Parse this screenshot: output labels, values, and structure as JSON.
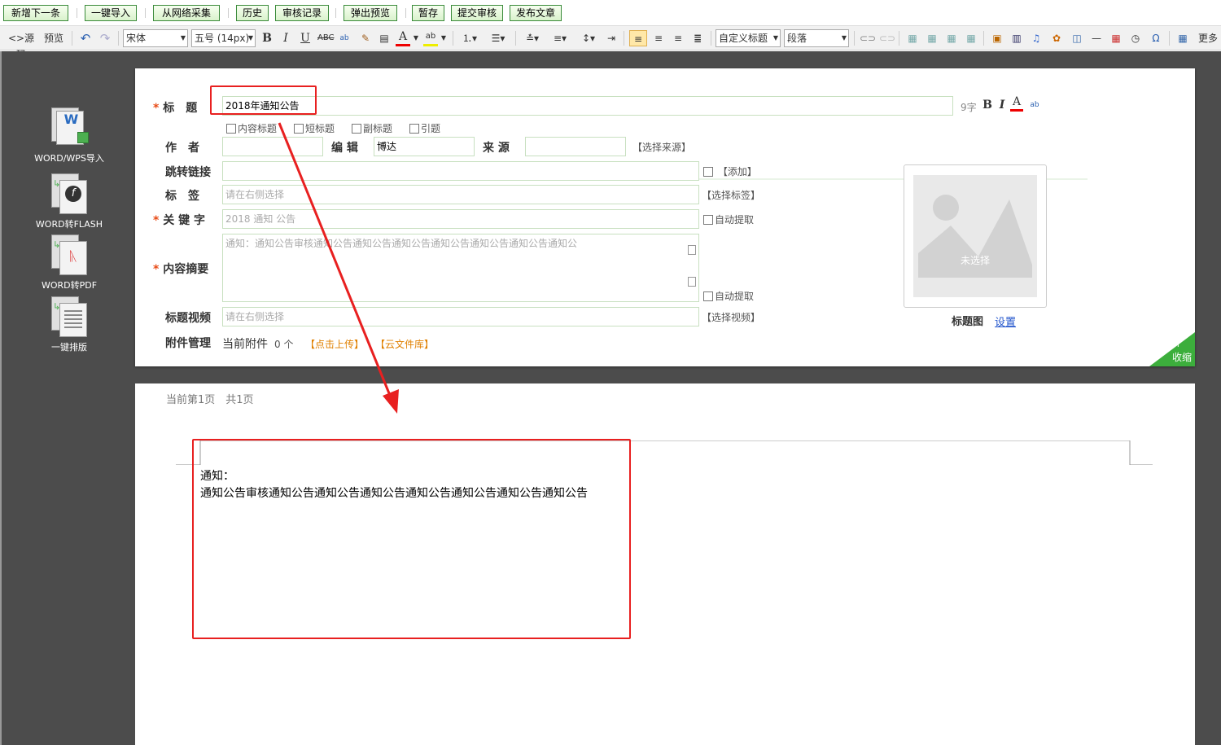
{
  "actions": [
    "新增下一条",
    "一键导入",
    "从网络采集",
    "历史",
    "审核记录",
    "弹出预览",
    "暂存",
    "提交审核",
    "发布文章"
  ],
  "toolbar": {
    "source": "源码",
    "preview": "预览",
    "font": "宋体",
    "size": "五号 (14px)",
    "heading": "自定义标题",
    "paragraph": "段落",
    "more": "更多"
  },
  "left_tools": [
    {
      "label": "WORD/WPS导入",
      "icon": "word-import-icon"
    },
    {
      "label": "WORD转FLASH",
      "icon": "word-to-flash-icon"
    },
    {
      "label": "WORD转PDF",
      "icon": "word-to-pdf-icon"
    },
    {
      "label": "一键排版",
      "icon": "auto-format-icon"
    }
  ],
  "form": {
    "title_label": "标　题",
    "title_value": "2018年通知公告",
    "title_count": "9字",
    "title_options": [
      "内容标题",
      "短标题",
      "副标题",
      "引题"
    ],
    "author_label": "作　者",
    "author_value": "",
    "editor_label": "编 辑",
    "editor_value": "博达",
    "source_label": "来 源",
    "source_value": "",
    "source_hint": "【选择来源】",
    "redirect_label": "跳转链接",
    "redirect_hint": "【添加】",
    "tags_label": "标　签",
    "tags_placeholder": "请在右侧选择",
    "tags_hint": "【选择标签】",
    "keywords_label": "关 键 字",
    "keywords_value": "2018 通知 公告",
    "auto_extract": "自动提取",
    "summary_label": "内容摘要",
    "summary_value": "通知：通知公告审核通知公告通知公告通知公告通知公告通知公告通知公告通知公",
    "video_label": "标题视频",
    "video_placeholder": "请在右侧选择",
    "video_hint": "【选择视频】",
    "attach_label": "附件管理",
    "attach_current": "当前附件",
    "attach_count": "0 个",
    "upload": "【点击上传】",
    "cloud": "【云文件库】",
    "image_empty": "未选择",
    "image_label": "标题图",
    "image_set": "设置",
    "collapse": "收缩"
  },
  "doc": {
    "page_info": "当前第1页　共1页",
    "line1": "通知：",
    "line2": "通知公告审核通知公告通知公告通知公告通知公告通知公告通知公告通知公告"
  },
  "colors": {
    "annotation": "#e82020",
    "accent_green": "#3a8a3a",
    "required": "#e84b16"
  }
}
